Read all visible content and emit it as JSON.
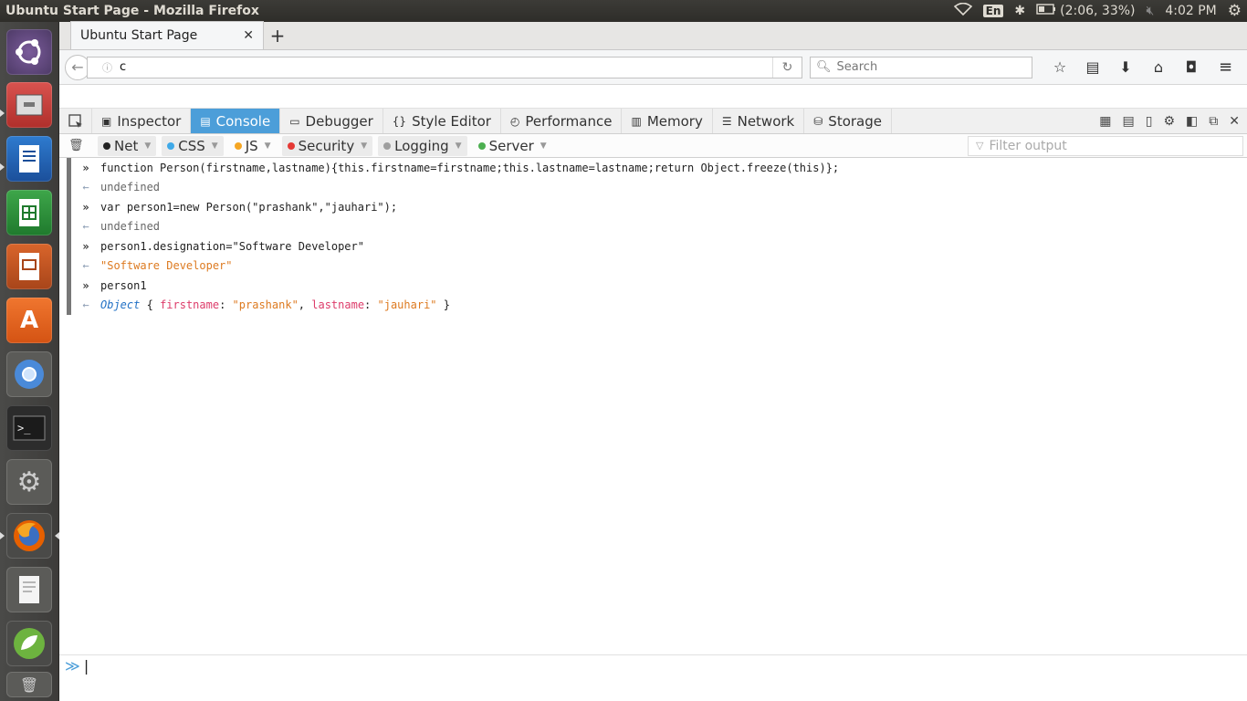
{
  "window_title": "Ubuntu Start Page - Mozilla Firefox",
  "indicators": {
    "language": "En",
    "battery": "(2:06, 33%)",
    "time": "4:02 PM"
  },
  "tab": {
    "title": "Ubuntu Start Page"
  },
  "urlbar": {
    "value": "c"
  },
  "searchbar": {
    "placeholder": "Search"
  },
  "devtools": {
    "tabs": [
      "Inspector",
      "Console",
      "Debugger",
      "Style Editor",
      "Performance",
      "Memory",
      "Network",
      "Storage"
    ],
    "active_tab": "Console",
    "filters": [
      {
        "label": "Net",
        "color": "#222222"
      },
      {
        "label": "CSS",
        "color": "#3fa9e8"
      },
      {
        "label": "JS",
        "color": "#f5a623"
      },
      {
        "label": "Security",
        "color": "#e53935"
      },
      {
        "label": "Logging",
        "color": "#9e9e9e"
      },
      {
        "label": "Server",
        "color": "#4caf50"
      }
    ],
    "filter_placeholder": "Filter output"
  },
  "console": {
    "lines": [
      {
        "type": "input",
        "text": "function Person(firstname,lastname){this.firstname=firstname;this.lastname=lastname;return Object.freeze(this)};"
      },
      {
        "type": "output",
        "kind": "undefined",
        "text": "undefined"
      },
      {
        "type": "input",
        "text": "var person1=new Person(\"prashank\",\"jauhari\");"
      },
      {
        "type": "output",
        "kind": "undefined",
        "text": "undefined"
      },
      {
        "type": "input",
        "text": "person1.designation=\"Software Developer\""
      },
      {
        "type": "output",
        "kind": "string",
        "text": "\"Software Developer\""
      },
      {
        "type": "input",
        "text": "person1"
      }
    ],
    "object_output": {
      "keyword": "Object",
      "open": "{",
      "prop1": "firstname",
      "val1": "\"prashank\"",
      "prop2": "lastname",
      "val2": "\"jauhari\"",
      "close": "}"
    }
  }
}
